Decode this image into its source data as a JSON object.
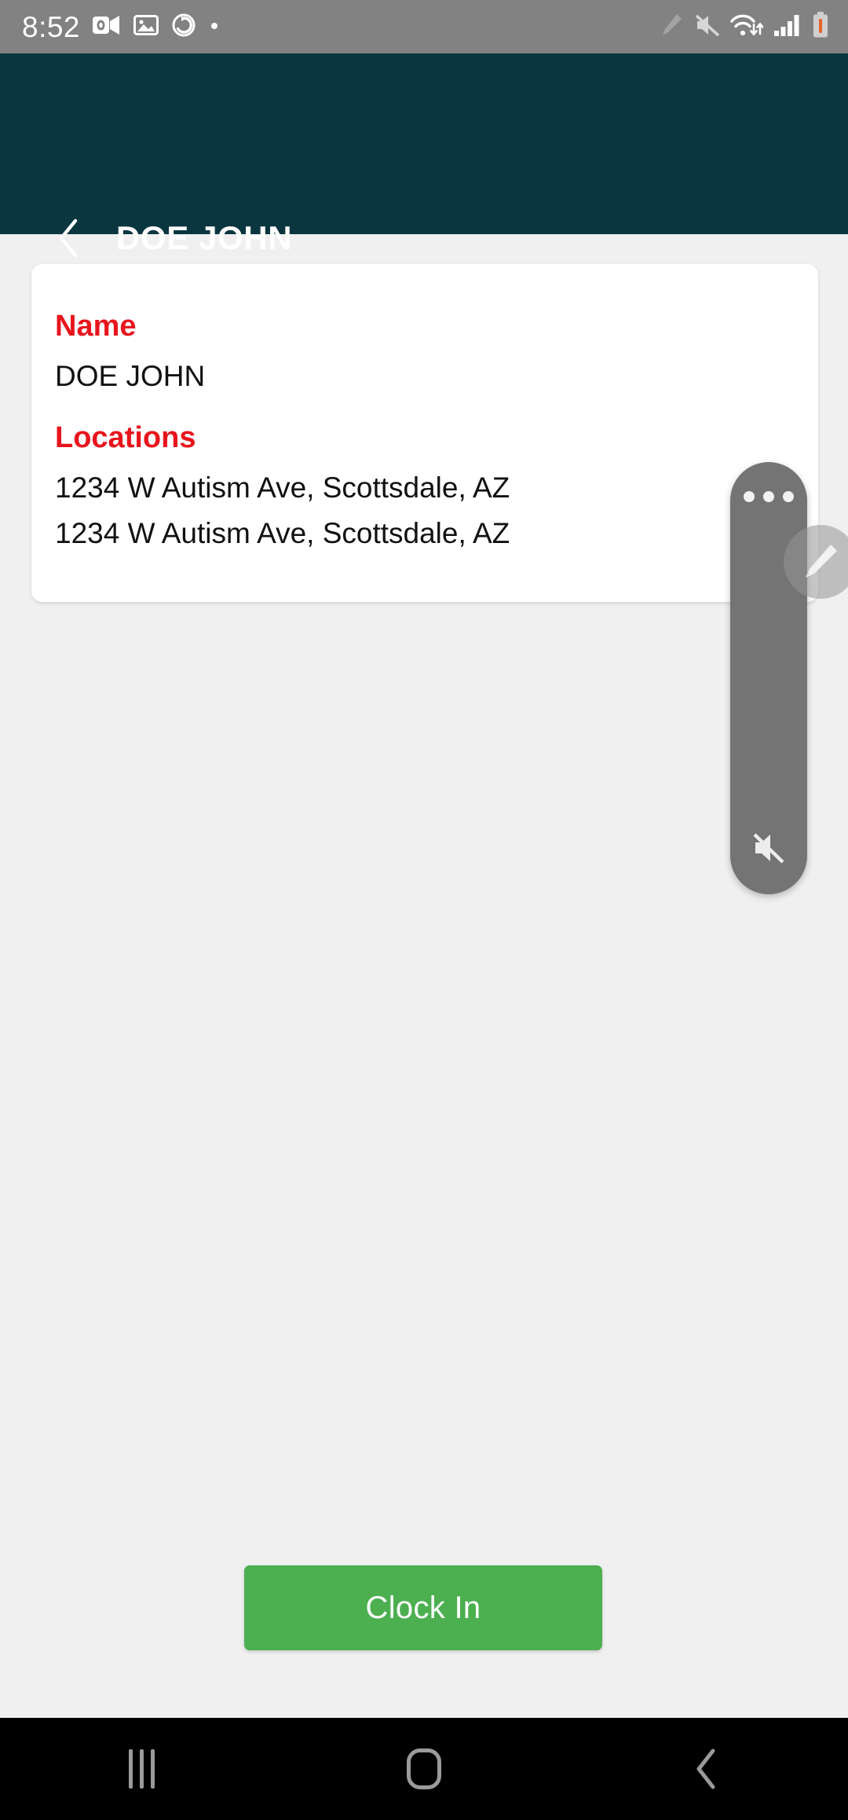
{
  "status_bar": {
    "clock": "8:52",
    "left_icons": [
      "outlook-icon",
      "gallery-image-icon",
      "sync-rotate-icon",
      "dot-indicator-icon"
    ],
    "right_icons": [
      "stylus-pencil-icon",
      "volume-muted-icon",
      "wifi-transfer-icon",
      "cellular-signal-icon",
      "battery-low-icon"
    ],
    "background_color": "#828282"
  },
  "app_bar": {
    "title": "DOE JOHN",
    "back_icon": "chevron-left-icon",
    "background_color": "#0a3640",
    "title_color": "#ffffff"
  },
  "detail_card": {
    "accent_color": "#e8151d",
    "fields": [
      {
        "label": "Name",
        "values": [
          "DOE JOHN"
        ]
      },
      {
        "label": "Locations",
        "values": [
          "1234 W Autism Ave, Scottsdale, AZ",
          "1234 W Autism Ave, Scottsdale, AZ"
        ]
      }
    ],
    "name_label": "Name",
    "name_value": "DOE JOHN",
    "locations_label": "Locations",
    "location_1": "1234 W Autism Ave, Scottsdale, AZ",
    "location_2": "1234 W Autism Ave, Scottsdale, AZ"
  },
  "primary_action": {
    "label": "Clock In",
    "color": "#4caf50",
    "text_color": "#ffffff"
  },
  "recorder_overlay": {
    "drag_handle_icon": "three-dots-handle-icon",
    "mute_icon": "volume-muted-icon",
    "stylus_icon": "stylus-pencil-icon",
    "background_color": "#747474"
  },
  "nav_bar": {
    "recents_icon": "recents-bars-icon",
    "home_icon": "home-square-icon",
    "back_icon": "chevron-left-icon",
    "background_color": "#000000"
  }
}
